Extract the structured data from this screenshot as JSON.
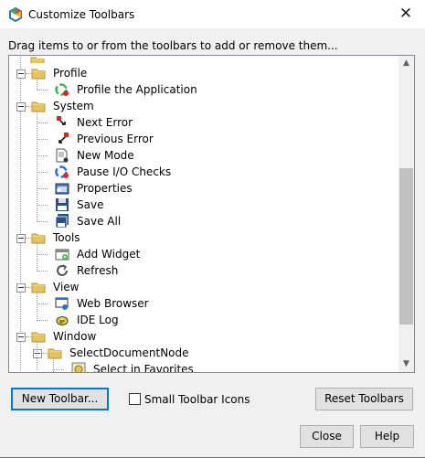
{
  "window": {
    "title": "Customize Toolbars",
    "close_glyph": "✕"
  },
  "instruction": "Drag items to or from the toolbars to add or remove them...",
  "tree": {
    "rows": [
      {
        "label": "Profile",
        "kind": "folder",
        "icon": "folder-icon"
      },
      {
        "label": "Profile the Application",
        "kind": "item",
        "icon": "profile-app-icon"
      },
      {
        "label": "System",
        "kind": "folder",
        "icon": "folder-icon"
      },
      {
        "label": "Next Error",
        "kind": "item",
        "icon": "next-error-icon"
      },
      {
        "label": "Previous Error",
        "kind": "item",
        "icon": "previous-error-icon"
      },
      {
        "label": "New Mode",
        "kind": "item",
        "icon": "new-mode-icon"
      },
      {
        "label": "Pause I/O Checks",
        "kind": "item",
        "icon": "pause-io-icon"
      },
      {
        "label": "Properties",
        "kind": "item",
        "icon": "properties-icon"
      },
      {
        "label": "Save",
        "kind": "item",
        "icon": "save-icon"
      },
      {
        "label": "Save All",
        "kind": "item",
        "icon": "save-all-icon"
      },
      {
        "label": "Tools",
        "kind": "folder",
        "icon": "folder-icon"
      },
      {
        "label": "Add Widget",
        "kind": "item",
        "icon": "add-widget-icon"
      },
      {
        "label": "Refresh",
        "kind": "item",
        "icon": "refresh-icon"
      },
      {
        "label": "View",
        "kind": "folder",
        "icon": "folder-icon"
      },
      {
        "label": "Web Browser",
        "kind": "item",
        "icon": "web-browser-icon"
      },
      {
        "label": "IDE Log",
        "kind": "item",
        "icon": "ide-log-icon"
      },
      {
        "label": "Window",
        "kind": "folder",
        "icon": "folder-icon"
      },
      {
        "label": "SelectDocumentNode",
        "kind": "subfolder",
        "icon": "folder-icon"
      },
      {
        "label": "Select in Favorites",
        "kind": "subitem",
        "icon": "select-favorites-icon"
      }
    ]
  },
  "buttons": {
    "new_toolbar": "New Toolbar...",
    "small_icons_label": "Small Toolbar Icons",
    "reset_toolbars": "Reset Toolbars",
    "close": "Close",
    "help": "Help"
  },
  "colors": {
    "accent": "#0078d7",
    "folder": "#e8c25a"
  }
}
